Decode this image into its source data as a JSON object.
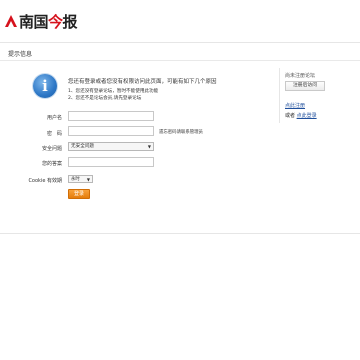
{
  "header": {
    "logo_text_pre": "南国",
    "logo_text_red": "今",
    "logo_text_post": "报"
  },
  "panel": {
    "title": "提示信息"
  },
  "message": {
    "title": "您还有登录或者您没有权限访问此页面，可能有如下几个原因",
    "line1": "1、您还没有登录论坛，暂时不能使用此功能",
    "line2": "2、您还不是论坛会员,请先登录论坛"
  },
  "form": {
    "username_label": "用户名",
    "username_value": "",
    "password_label": "密　码",
    "password_value": "",
    "password_hint": "遗忘密码请联系管理员",
    "security_label": "安全问题",
    "security_selected": "无安全问题",
    "answer_label": "您的答案",
    "answer_value": "",
    "cookie_label": "Cookie 有效期",
    "cookie_selected": "永时",
    "login_button": "登录"
  },
  "sidebar": {
    "label": "尚未注册论坛",
    "register_button": "注册后访问",
    "link1": "点此注册",
    "line2_prefix": "或者 ",
    "link2": "点此登录"
  },
  "colors": {
    "brand_red": "#d6121d",
    "button_orange": "#e57d0c",
    "link_blue": "#1f4f9c",
    "icon_blue": "#2d77c6"
  }
}
